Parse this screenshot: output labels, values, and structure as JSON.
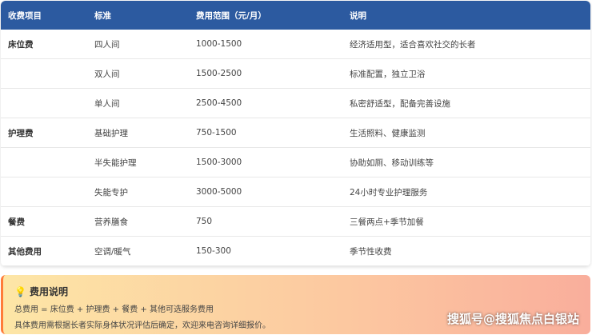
{
  "headers": [
    "收费项目",
    "标准",
    "费用范围（元/月）",
    "说明"
  ],
  "rows": [
    [
      "床位费",
      "四人间",
      "1000-1500",
      "经济适用型，适合喜欢社交的长者"
    ],
    [
      "",
      "双人间",
      "1500-2500",
      "标准配置，独立卫浴"
    ],
    [
      "",
      "单人间",
      "2500-4500",
      "私密舒适型，配备完善设施"
    ],
    [
      "护理费",
      "基础护理",
      "750-1500",
      "生活照料、健康监测"
    ],
    [
      "",
      "半失能护理",
      "1500-3000",
      "协助如厕、移动训练等"
    ],
    [
      "",
      "失能专护",
      "3000-5000",
      "24小时专业护理服务"
    ],
    [
      "餐费",
      "营养膳食",
      "750",
      "三餐两点+季节加餐"
    ],
    [
      "其他费用",
      "空调/暖气",
      "150-300",
      "季节性收费"
    ]
  ],
  "note": {
    "icon": "lightbulb-icon",
    "title": "费用说明",
    "line1": "总费用 = 床位费 + 护理费 + 餐费 + 其他可选服务费用",
    "line2": "具体费用需根据长者实际身体状况评估后确定，欢迎来电咨询详细报价。"
  },
  "watermark": "搜狐号@搜狐焦点白银站"
}
